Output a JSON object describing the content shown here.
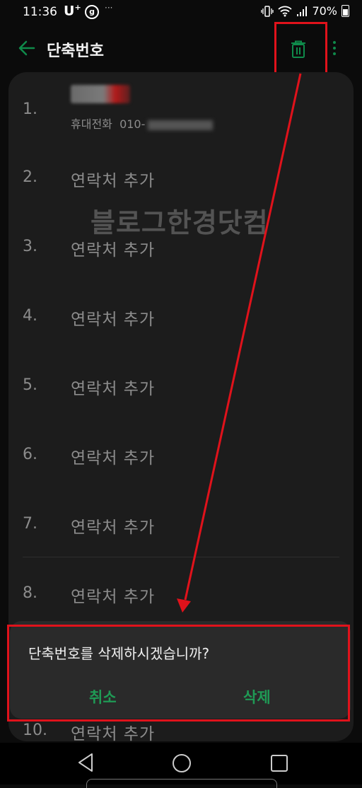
{
  "status_bar": {
    "time": "11:36",
    "carrier": "U",
    "carrier_plus": "+",
    "carrier_badge": "g",
    "dots": "···",
    "battery": "70%"
  },
  "app_bar": {
    "title": "단축번호"
  },
  "list": [
    {
      "number": "1.",
      "contact_type": "휴대전화",
      "phone_prefix": "010-"
    },
    {
      "number": "2.",
      "label": "연락처 추가"
    },
    {
      "number": "3.",
      "label": "연락처 추가"
    },
    {
      "number": "4.",
      "label": "연락처 추가"
    },
    {
      "number": "5.",
      "label": "연락처 추가"
    },
    {
      "number": "6.",
      "label": "연락처 추가"
    },
    {
      "number": "7.",
      "label": "연락처 추가"
    },
    {
      "number": "8.",
      "label": "연락처 추가"
    },
    {
      "number": "10.",
      "label": "연락처 추가"
    }
  ],
  "watermark": "블로그한경닷컴",
  "dialog": {
    "message": "단축번호를 삭제하시겠습니까?",
    "cancel_label": "취소",
    "delete_label": "삭제"
  },
  "colors": {
    "accent": "#1f9a55",
    "highlight": "#e0121b",
    "background": "#0b0b0b",
    "card": "#1c1c1c"
  },
  "icons": [
    "back-arrow-icon",
    "trash-icon",
    "more-vert-icon",
    "nav-back-icon",
    "nav-home-icon",
    "nav-recent-icon"
  ]
}
